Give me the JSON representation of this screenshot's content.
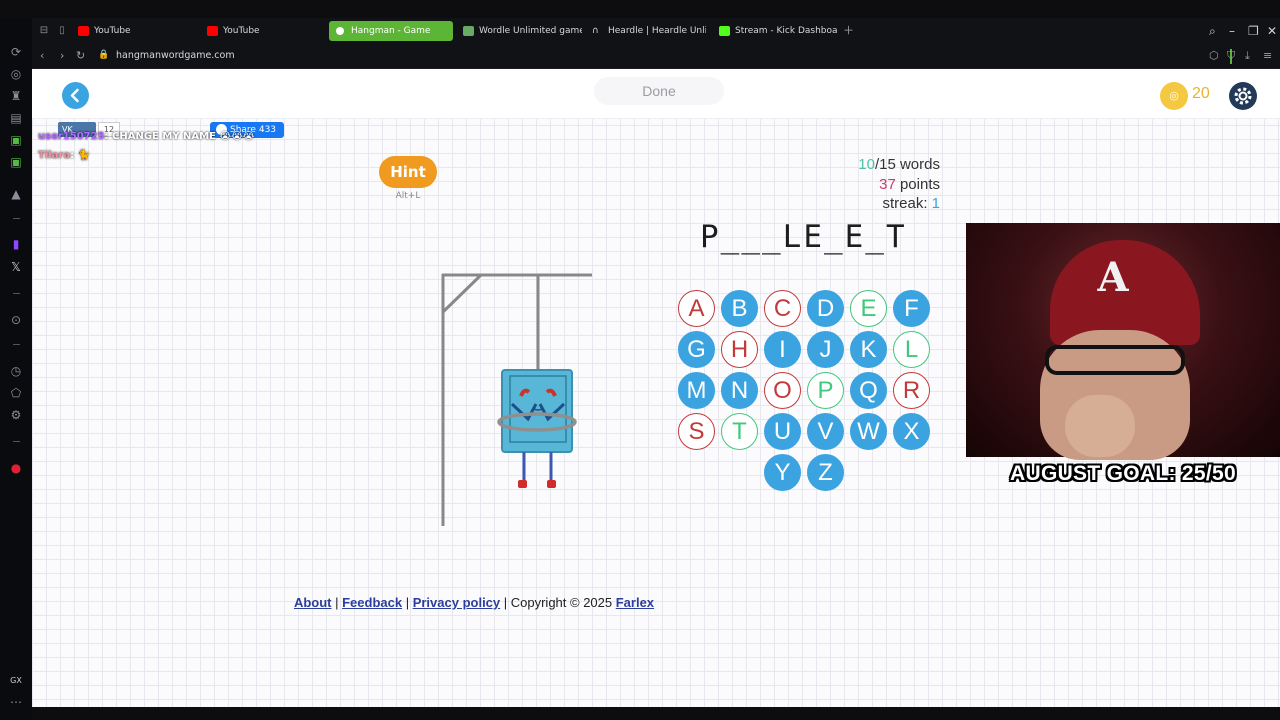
{
  "browser": {
    "tabs": [
      {
        "label": "YouTube",
        "icon": "youtube-icon"
      },
      {
        "label": "YouTube",
        "icon": "youtube-icon"
      },
      {
        "label": "Hangman - Game",
        "icon": "hangman-favicon",
        "active": true
      },
      {
        "label": "Wordle Unlimited games",
        "icon": "wordle-favicon"
      },
      {
        "label": "Heardle | Heardle Unlimi",
        "icon": "headphones-icon"
      },
      {
        "label": "Stream - Kick Dashboard",
        "icon": "kick-icon"
      }
    ],
    "url": "hangmanwordgame.com"
  },
  "header": {
    "done_label": "Done",
    "coins": "20"
  },
  "game": {
    "hint_label": "Hint",
    "hint_shortcut": "Alt+L",
    "words_done": "10",
    "words_total": "/15 words",
    "points_value": "37",
    "points_label": " points",
    "streak_label": "streak: ",
    "streak_value": "1",
    "word_display": "P___LE_E_T",
    "letters": [
      {
        "ch": "A",
        "state": "wrong"
      },
      {
        "ch": "B",
        "state": "avail"
      },
      {
        "ch": "C",
        "state": "wrong"
      },
      {
        "ch": "D",
        "state": "avail"
      },
      {
        "ch": "E",
        "state": "right"
      },
      {
        "ch": "F",
        "state": "avail"
      },
      {
        "ch": "G",
        "state": "avail"
      },
      {
        "ch": "H",
        "state": "wrong"
      },
      {
        "ch": "I",
        "state": "avail"
      },
      {
        "ch": "J",
        "state": "avail"
      },
      {
        "ch": "K",
        "state": "avail"
      },
      {
        "ch": "L",
        "state": "right"
      },
      {
        "ch": "M",
        "state": "avail"
      },
      {
        "ch": "N",
        "state": "avail"
      },
      {
        "ch": "O",
        "state": "wrong"
      },
      {
        "ch": "P",
        "state": "right"
      },
      {
        "ch": "Q",
        "state": "avail"
      },
      {
        "ch": "R",
        "state": "wrong"
      },
      {
        "ch": "S",
        "state": "wrong"
      },
      {
        "ch": "T",
        "state": "right"
      },
      {
        "ch": "U",
        "state": "avail"
      },
      {
        "ch": "V",
        "state": "avail"
      },
      {
        "ch": "W",
        "state": "avail"
      },
      {
        "ch": "X",
        "state": "avail"
      },
      {
        "ch": "Y",
        "state": "avail"
      },
      {
        "ch": "Z",
        "state": "avail"
      }
    ]
  },
  "footer": {
    "about": "About",
    "sep": " | ",
    "feedback": "Feedback",
    "privacy": "Privacy policy",
    "copyright": " | Copyright © 2025 ",
    "farlex": "Farlex"
  },
  "overlay": {
    "vk_label": "VK",
    "vk_count": "12",
    "share_label": "Share",
    "share_count": "433",
    "chat": [
      {
        "user": "user150725",
        "text": ": CHANGE MY NAME 😭😭😭",
        "color": "#b56bff"
      },
      {
        "user": "Tilara",
        "text": ": 🐈",
        "color": "#ff8fa3"
      }
    ],
    "goal": "AUGUST GOAL: 25/50"
  },
  "colors": {
    "accent_blue": "#3ba3e0",
    "wrong_red": "#c23a3a",
    "right_green": "#3ec97b",
    "hint_orange": "#f09a1f",
    "opera_green": "#5db536"
  }
}
